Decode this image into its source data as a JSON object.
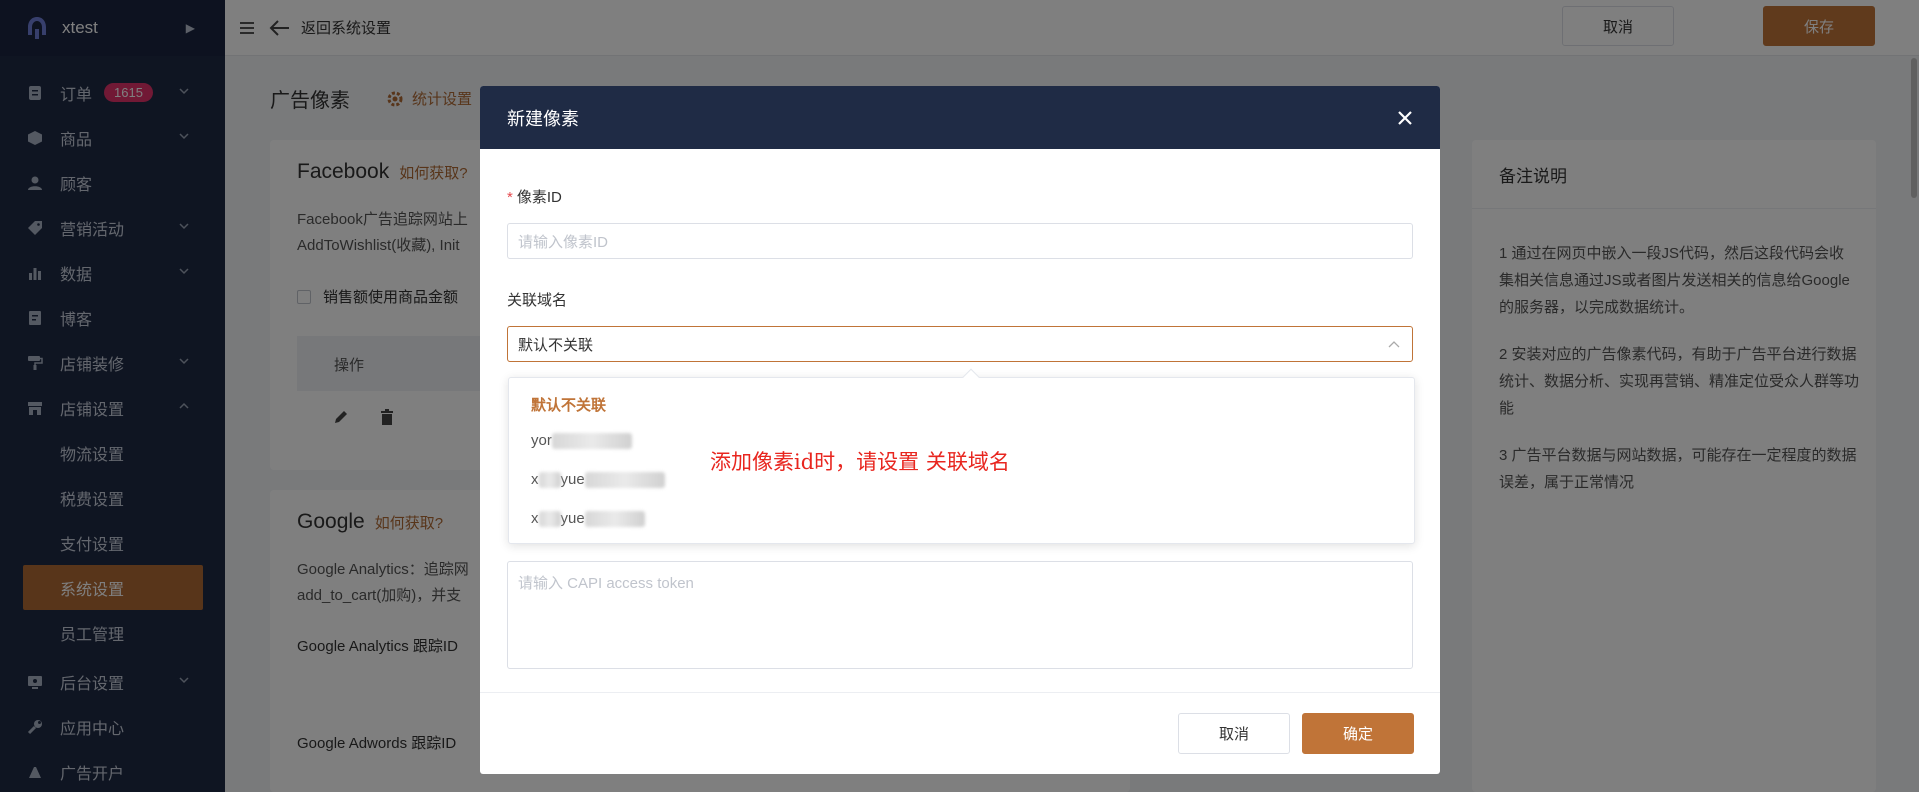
{
  "sidebar": {
    "brand": "xtest",
    "items": [
      {
        "label": "订单",
        "badge": "1615"
      },
      {
        "label": "商品"
      },
      {
        "label": "顾客"
      },
      {
        "label": "营销活动"
      },
      {
        "label": "数据"
      },
      {
        "label": "博客"
      },
      {
        "label": "店铺装修"
      },
      {
        "label": "店铺设置"
      }
    ],
    "sub_items": [
      "物流设置",
      "税费设置",
      "支付设置",
      "系统设置",
      "员工管理"
    ],
    "items_bottom": [
      {
        "label": "后台设置"
      },
      {
        "label": "应用中心"
      },
      {
        "label": "广告开户"
      }
    ]
  },
  "topbar": {
    "back_label": "返回系统设置",
    "cancel_label": "取消",
    "save_label": "保存"
  },
  "page": {
    "title": "广告像素",
    "stat_link": "统计设置"
  },
  "facebook": {
    "title": "Facebook",
    "howto": "如何获取?",
    "desc_line1": "Facebook广告追踪网站上",
    "desc_line2": "AddToWishlist(收藏), Init",
    "checkbox_label": "销售额使用商品金额",
    "table_header": "操作"
  },
  "google": {
    "title": "Google",
    "howto": "如何获取?",
    "desc_line1": "Google Analytics：追踪网",
    "desc_line2": "add_to_cart(加购)，并支",
    "label_analytics": "Google Analytics 跟踪ID",
    "label_adwords": "Google Adwords 跟踪ID"
  },
  "notes": {
    "title": "备注说明",
    "items": [
      "1 通过在网页中嵌入一段JS代码，然后这段代码会收集相关信息通过JS或者图片发送相关的信息给Google的服务器，以完成数据统计。",
      "2 安装对应的广告像素代码，有助于广告平台进行数据统计、数据分析、实现再营销、精准定位受众人群等功能",
      "3 广告平台数据与网站数据，可能存在一定程度的数据误差，属于正常情况"
    ]
  },
  "modal": {
    "title": "新建像素",
    "pixel_id_label": "像素ID",
    "pixel_id_required": "*",
    "pixel_id_placeholder": "请输入像素ID",
    "domain_label": "关联域名",
    "domain_value": "默认不关联",
    "token_placeholder": "请输入 CAPI access token",
    "cancel_label": "取消",
    "ok_label": "确定"
  },
  "dropdown": {
    "options": [
      {
        "label": "默认不关联",
        "selected": true
      },
      {
        "label": "yor",
        "redacted": true
      },
      {
        "label": "x",
        "suffix": "yue",
        "redacted": true
      },
      {
        "label": "x",
        "suffix": "yue",
        "redacted": true
      }
    ]
  },
  "annotation": "添加像素id时，请设置 关联域名",
  "colors": {
    "sidebar_bg": "#1f2b45",
    "accent": "#c07438",
    "badge": "#e2336b",
    "annotation": "#e8261f"
  }
}
